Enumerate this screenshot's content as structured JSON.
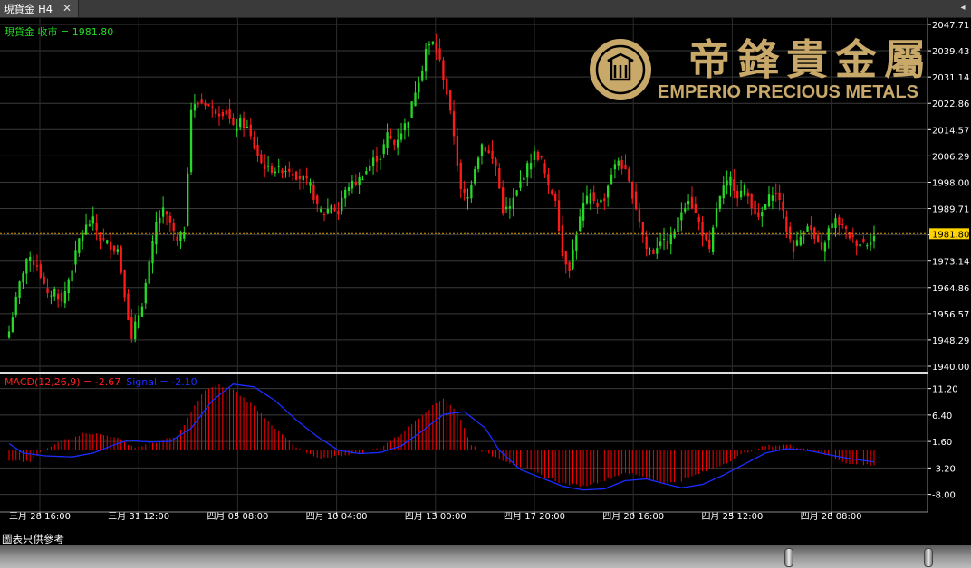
{
  "window": {
    "tab_label": "現貨金 H4",
    "close_glyph": "✕",
    "scroll_glyph": "◂"
  },
  "price_panel": {
    "label": "現貨金 收市 = 1981.80",
    "label_color": "#26d926",
    "current_price": "1981.80",
    "y_ticks": [
      "2047.71",
      "2039.43",
      "2031.14",
      "2022.86",
      "2014.57",
      "2006.29",
      "1998.00",
      "1989.71",
      "1981.43",
      "1973.14",
      "1964.86",
      "1956.57",
      "1948.29",
      "1940.00"
    ]
  },
  "macd_panel": {
    "label_macd": "MACD(12,26,9) = -2.67",
    "label_signal": "Signal = -2.10",
    "macd_color": "#ff2020",
    "signal_color": "#1a2dff",
    "y_ticks": [
      "11.20",
      "6.40",
      "1.60",
      "-3.20",
      "-8.00"
    ]
  },
  "x_ticks": [
    "三月 28 16:00",
    "三月 31 12:00",
    "四月 05 08:00",
    "四月 10 04:00",
    "四月 13 00:00",
    "四月 17 20:00",
    "四月 20 16:00",
    "四月 25 12:00",
    "四月 28 08:00"
  ],
  "logo": {
    "chinese": "帝鋒貴金屬",
    "english": "EMPERIO PRECIOUS METALS",
    "color": "#c9a96a"
  },
  "footer": {
    "disclaimer": "圖表只供參考"
  },
  "chart_data": [
    {
      "type": "candlestick",
      "title": "現貨金 H4",
      "series_name": "現貨金 收市",
      "last_close": 1981.8,
      "ylim": [
        1940.0,
        2047.71
      ],
      "grid": true,
      "up_color": "#26d926",
      "down_color": "#ff1a1a",
      "x_labels": [
        "三月 28 16:00",
        "三月 31 12:00",
        "四月 05 08:00",
        "四月 10 04:00",
        "四月 13 00:00",
        "四月 17 20:00",
        "四月 20 16:00",
        "四月 25 12:00",
        "四月 28 08:00"
      ],
      "anchors": [
        [
          0,
          1951
        ],
        [
          3,
          1966
        ],
        [
          5,
          1974
        ],
        [
          8,
          1972
        ],
        [
          11,
          1962
        ],
        [
          13,
          1964
        ],
        [
          15,
          1960
        ],
        [
          18,
          1971
        ],
        [
          20,
          1980
        ],
        [
          22,
          1984
        ],
        [
          24,
          1986
        ],
        [
          26,
          1980
        ],
        [
          28,
          1979
        ],
        [
          30,
          1977
        ],
        [
          31,
          1977
        ],
        [
          33,
          1963
        ],
        [
          35,
          1948
        ],
        [
          36,
          1953
        ],
        [
          38,
          1960
        ],
        [
          40,
          1972
        ],
        [
          42,
          1985
        ],
        [
          44,
          1989
        ],
        [
          46,
          1985
        ],
        [
          48,
          1979
        ],
        [
          50,
          1983
        ],
        [
          52,
          2021
        ],
        [
          54,
          2023
        ],
        [
          56,
          2023
        ],
        [
          58,
          2021
        ],
        [
          60,
          2020
        ],
        [
          62,
          2020
        ],
        [
          64,
          2015
        ],
        [
          66,
          2017
        ],
        [
          68,
          2015
        ],
        [
          70,
          2009
        ],
        [
          72,
          2004
        ],
        [
          74,
          2002
        ],
        [
          76,
          2002
        ],
        [
          78,
          2002
        ],
        [
          80,
          2002
        ],
        [
          82,
          2000
        ],
        [
          84,
          1999
        ],
        [
          86,
          1997
        ],
        [
          88,
          1990
        ],
        [
          90,
          1988
        ],
        [
          92,
          1991
        ],
        [
          94,
          1988
        ],
        [
          95,
          1993
        ],
        [
          97,
          1997
        ],
        [
          99,
          1998
        ],
        [
          101,
          2000
        ],
        [
          104,
          2005
        ],
        [
          106,
          2006
        ],
        [
          108,
          2013
        ],
        [
          110,
          2010
        ],
        [
          112,
          2014
        ],
        [
          114,
          2018
        ],
        [
          116,
          2027
        ],
        [
          118,
          2034
        ],
        [
          119,
          2040
        ],
        [
          121,
          2042
        ],
        [
          123,
          2036
        ],
        [
          125,
          2026
        ],
        [
          127,
          2013
        ],
        [
          129,
          1995
        ],
        [
          131,
          1993
        ],
        [
          133,
          2003
        ],
        [
          135,
          2010
        ],
        [
          137,
          2007
        ],
        [
          139,
          2003
        ],
        [
          141,
          1989
        ],
        [
          143,
          1990
        ],
        [
          145,
          1995
        ],
        [
          146,
          1998
        ],
        [
          148,
          2003
        ],
        [
          150,
          2007
        ],
        [
          152,
          2005
        ],
        [
          154,
          1996
        ],
        [
          156,
          1993
        ],
        [
          158,
          1975
        ],
        [
          160,
          1971
        ],
        [
          162,
          1982
        ],
        [
          164,
          1991
        ],
        [
          166,
          1994
        ],
        [
          168,
          1991
        ],
        [
          170,
          1993
        ],
        [
          172,
          2001
        ],
        [
          174,
          2005
        ],
        [
          176,
          2001
        ],
        [
          178,
          1994
        ],
        [
          180,
          1986
        ],
        [
          182,
          1977
        ],
        [
          184,
          1976
        ],
        [
          186,
          1980
        ],
        [
          188,
          1978
        ],
        [
          190,
          1983
        ],
        [
          192,
          1989
        ],
        [
          194,
          1993
        ],
        [
          196,
          1988
        ],
        [
          198,
          1982
        ],
        [
          200,
          1976
        ],
        [
          202,
          1990
        ],
        [
          204,
          1996
        ],
        [
          206,
          1999
        ],
        [
          208,
          1994
        ],
        [
          210,
          1996
        ],
        [
          212,
          1991
        ],
        [
          214,
          1986
        ],
        [
          216,
          1991
        ],
        [
          218,
          1995
        ],
        [
          220,
          1993
        ],
        [
          222,
          1983
        ],
        [
          224,
          1977
        ],
        [
          226,
          1981
        ],
        [
          228,
          1985
        ],
        [
          230,
          1980
        ],
        [
          232,
          1976
        ],
        [
          234,
          1983
        ],
        [
          236,
          1986
        ],
        [
          238,
          1984
        ],
        [
          240,
          1981
        ],
        [
          242,
          1979
        ],
        [
          245,
          1979
        ],
        [
          247,
          1981
        ]
      ]
    },
    {
      "type": "macd",
      "title": "MACD(12,26,9)",
      "macd_last": -2.67,
      "signal_last": -2.1,
      "ylim": [
        -10.2,
        13.6
      ],
      "histogram_anchors": [
        [
          0,
          -2
        ],
        [
          6,
          -2
        ],
        [
          10,
          0
        ],
        [
          16,
          2
        ],
        [
          22,
          3.2
        ],
        [
          30,
          2.5
        ],
        [
          36,
          0.5
        ],
        [
          42,
          1.5
        ],
        [
          48,
          2.5
        ],
        [
          52,
          7
        ],
        [
          56,
          11
        ],
        [
          60,
          11.8
        ],
        [
          64,
          11
        ],
        [
          70,
          8
        ],
        [
          76,
          4
        ],
        [
          82,
          0.5
        ],
        [
          88,
          -1.5
        ],
        [
          94,
          -1
        ],
        [
          100,
          -0.5
        ],
        [
          106,
          0.5
        ],
        [
          112,
          3
        ],
        [
          118,
          6.5
        ],
        [
          124,
          9.5
        ],
        [
          128,
          7
        ],
        [
          132,
          1
        ],
        [
          136,
          -0.5
        ],
        [
          140,
          -1.5
        ],
        [
          146,
          -3
        ],
        [
          152,
          -4.5
        ],
        [
          158,
          -6
        ],
        [
          164,
          -6.5
        ],
        [
          170,
          -5.5
        ],
        [
          176,
          -4
        ],
        [
          182,
          -5
        ],
        [
          188,
          -6
        ],
        [
          192,
          -5.5
        ],
        [
          198,
          -4
        ],
        [
          204,
          -2.5
        ],
        [
          210,
          -0.5
        ],
        [
          216,
          0.8
        ],
        [
          222,
          1
        ],
        [
          228,
          0.3
        ],
        [
          234,
          -1
        ],
        [
          240,
          -2.5
        ],
        [
          247,
          -2.67
        ]
      ],
      "signal_anchors": [
        [
          0,
          1.2
        ],
        [
          4,
          -0.5
        ],
        [
          10,
          -1
        ],
        [
          18,
          -1.2
        ],
        [
          24,
          -0.5
        ],
        [
          30,
          1
        ],
        [
          34,
          1.8
        ],
        [
          40,
          1.5
        ],
        [
          46,
          1.6
        ],
        [
          52,
          4
        ],
        [
          58,
          9
        ],
        [
          64,
          12
        ],
        [
          70,
          11.5
        ],
        [
          76,
          9
        ],
        [
          82,
          5.5
        ],
        [
          88,
          2.5
        ],
        [
          94,
          0
        ],
        [
          100,
          -0.6
        ],
        [
          106,
          -0.4
        ],
        [
          112,
          0.8
        ],
        [
          118,
          3.5
        ],
        [
          124,
          6.5
        ],
        [
          130,
          7
        ],
        [
          136,
          4
        ],
        [
          140,
          0
        ],
        [
          146,
          -3.5
        ],
        [
          152,
          -5
        ],
        [
          158,
          -6.5
        ],
        [
          164,
          -7.2
        ],
        [
          170,
          -7
        ],
        [
          176,
          -5.5
        ],
        [
          182,
          -5.2
        ],
        [
          188,
          -6.2
        ],
        [
          192,
          -6.8
        ],
        [
          198,
          -6.2
        ],
        [
          204,
          -4.5
        ],
        [
          210,
          -2.5
        ],
        [
          216,
          -0.5
        ],
        [
          222,
          0.3
        ],
        [
          228,
          0
        ],
        [
          234,
          -0.8
        ],
        [
          240,
          -1.5
        ],
        [
          247,
          -2.1
        ]
      ]
    }
  ]
}
